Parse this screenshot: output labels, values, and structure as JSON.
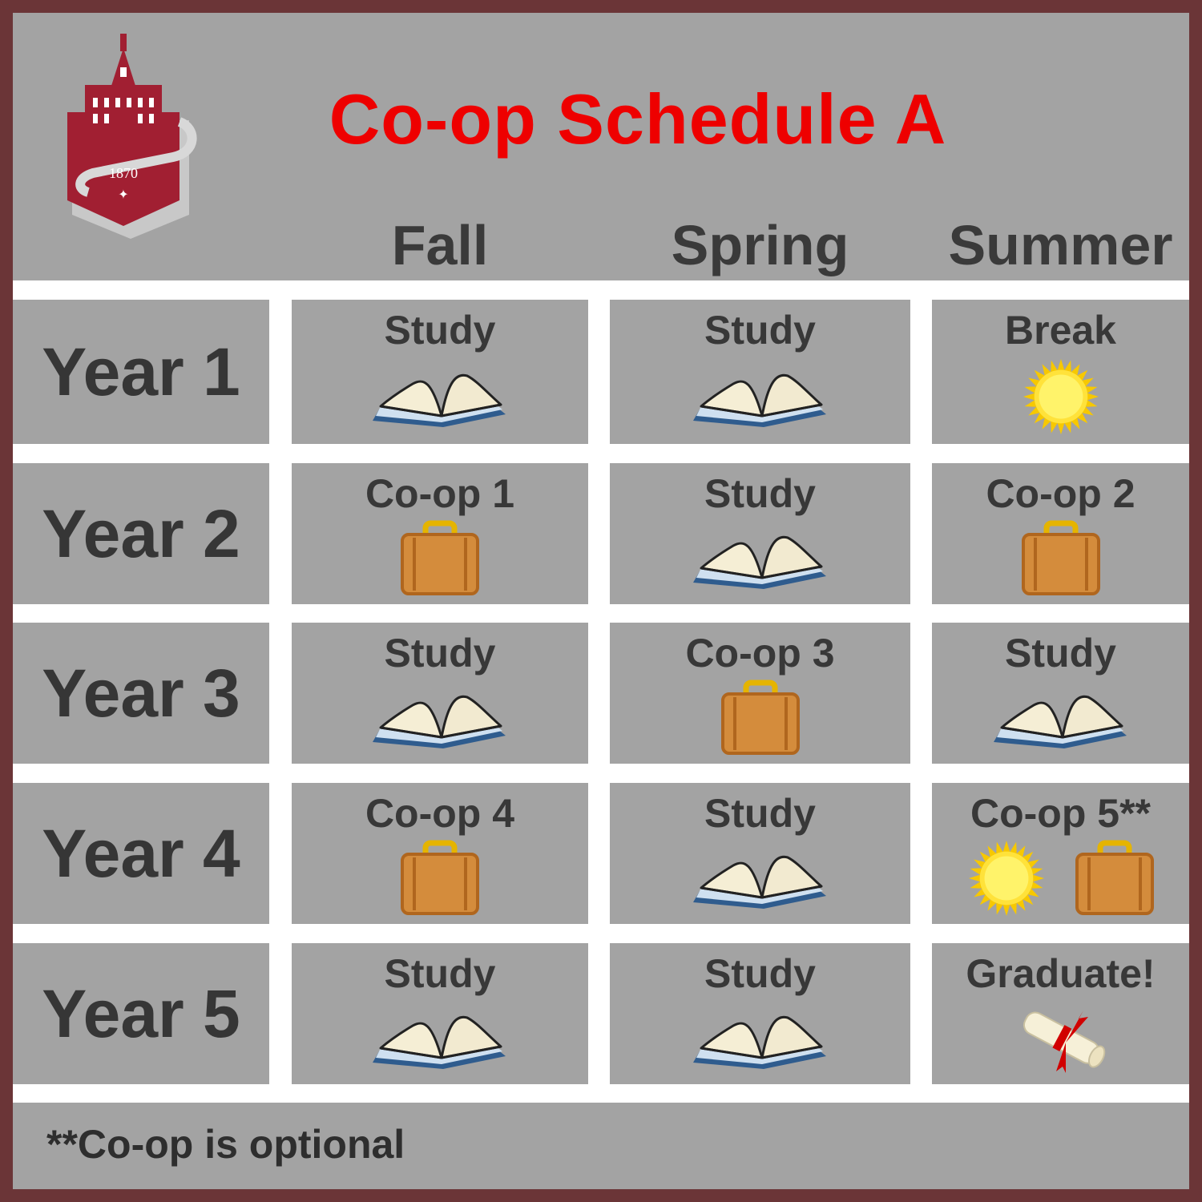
{
  "title": "Co-op Schedule A",
  "logo": {
    "year": "1870"
  },
  "seasons": [
    "Fall",
    "Spring",
    "Summer"
  ],
  "rows": [
    {
      "label": "Year 1",
      "cells": [
        {
          "label": "Study",
          "icons": [
            "book-icon"
          ]
        },
        {
          "label": "Study",
          "icons": [
            "book-icon"
          ]
        },
        {
          "label": "Break",
          "icons": [
            "sun-icon"
          ]
        }
      ]
    },
    {
      "label": "Year 2",
      "cells": [
        {
          "label": "Co-op 1",
          "icons": [
            "suitcase-icon"
          ]
        },
        {
          "label": "Study",
          "icons": [
            "book-icon"
          ]
        },
        {
          "label": "Co-op 2",
          "icons": [
            "suitcase-icon"
          ]
        }
      ]
    },
    {
      "label": "Year 3",
      "cells": [
        {
          "label": "Study",
          "icons": [
            "book-icon"
          ]
        },
        {
          "label": "Co-op 3",
          "icons": [
            "suitcase-icon"
          ]
        },
        {
          "label": "Study",
          "icons": [
            "book-icon"
          ]
        }
      ]
    },
    {
      "label": "Year 4",
      "cells": [
        {
          "label": "Co-op 4",
          "icons": [
            "suitcase-icon"
          ]
        },
        {
          "label": "Study",
          "icons": [
            "book-icon"
          ]
        },
        {
          "label": "Co-op 5**",
          "icons": [
            "sun-icon",
            "suitcase-icon"
          ]
        }
      ]
    },
    {
      "label": "Year 5",
      "cells": [
        {
          "label": "Study",
          "icons": [
            "book-icon"
          ]
        },
        {
          "label": "Study",
          "icons": [
            "book-icon"
          ]
        },
        {
          "label": "Graduate!",
          "icons": [
            "diploma-icon"
          ]
        }
      ]
    }
  ],
  "footnote": "**Co-op is optional",
  "colors": {
    "title": "#ee0000",
    "border": "#6b3537",
    "panel": "#a3a3a3",
    "crest": "#a11f32"
  }
}
